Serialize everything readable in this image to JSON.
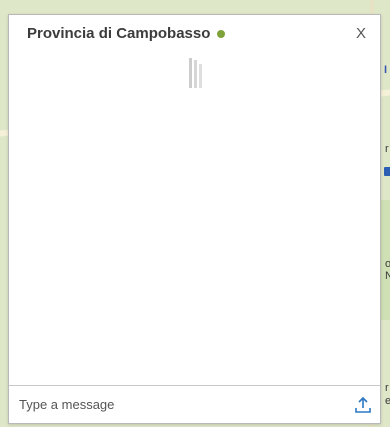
{
  "chat": {
    "title": "Provincia di Campobasso",
    "status_color": "#7fa33a",
    "close_label": "X",
    "input_placeholder": "Type a message",
    "icons": {
      "status": "online-status-dot",
      "loading": "loading-bars-icon",
      "upload": "upload-icon"
    }
  },
  "map": {
    "edge_labels": [
      "I",
      "r",
      "o",
      "N",
      "r",
      "e"
    ]
  },
  "colors": {
    "accent": "#2b78c4",
    "status_online": "#7fa33a"
  }
}
